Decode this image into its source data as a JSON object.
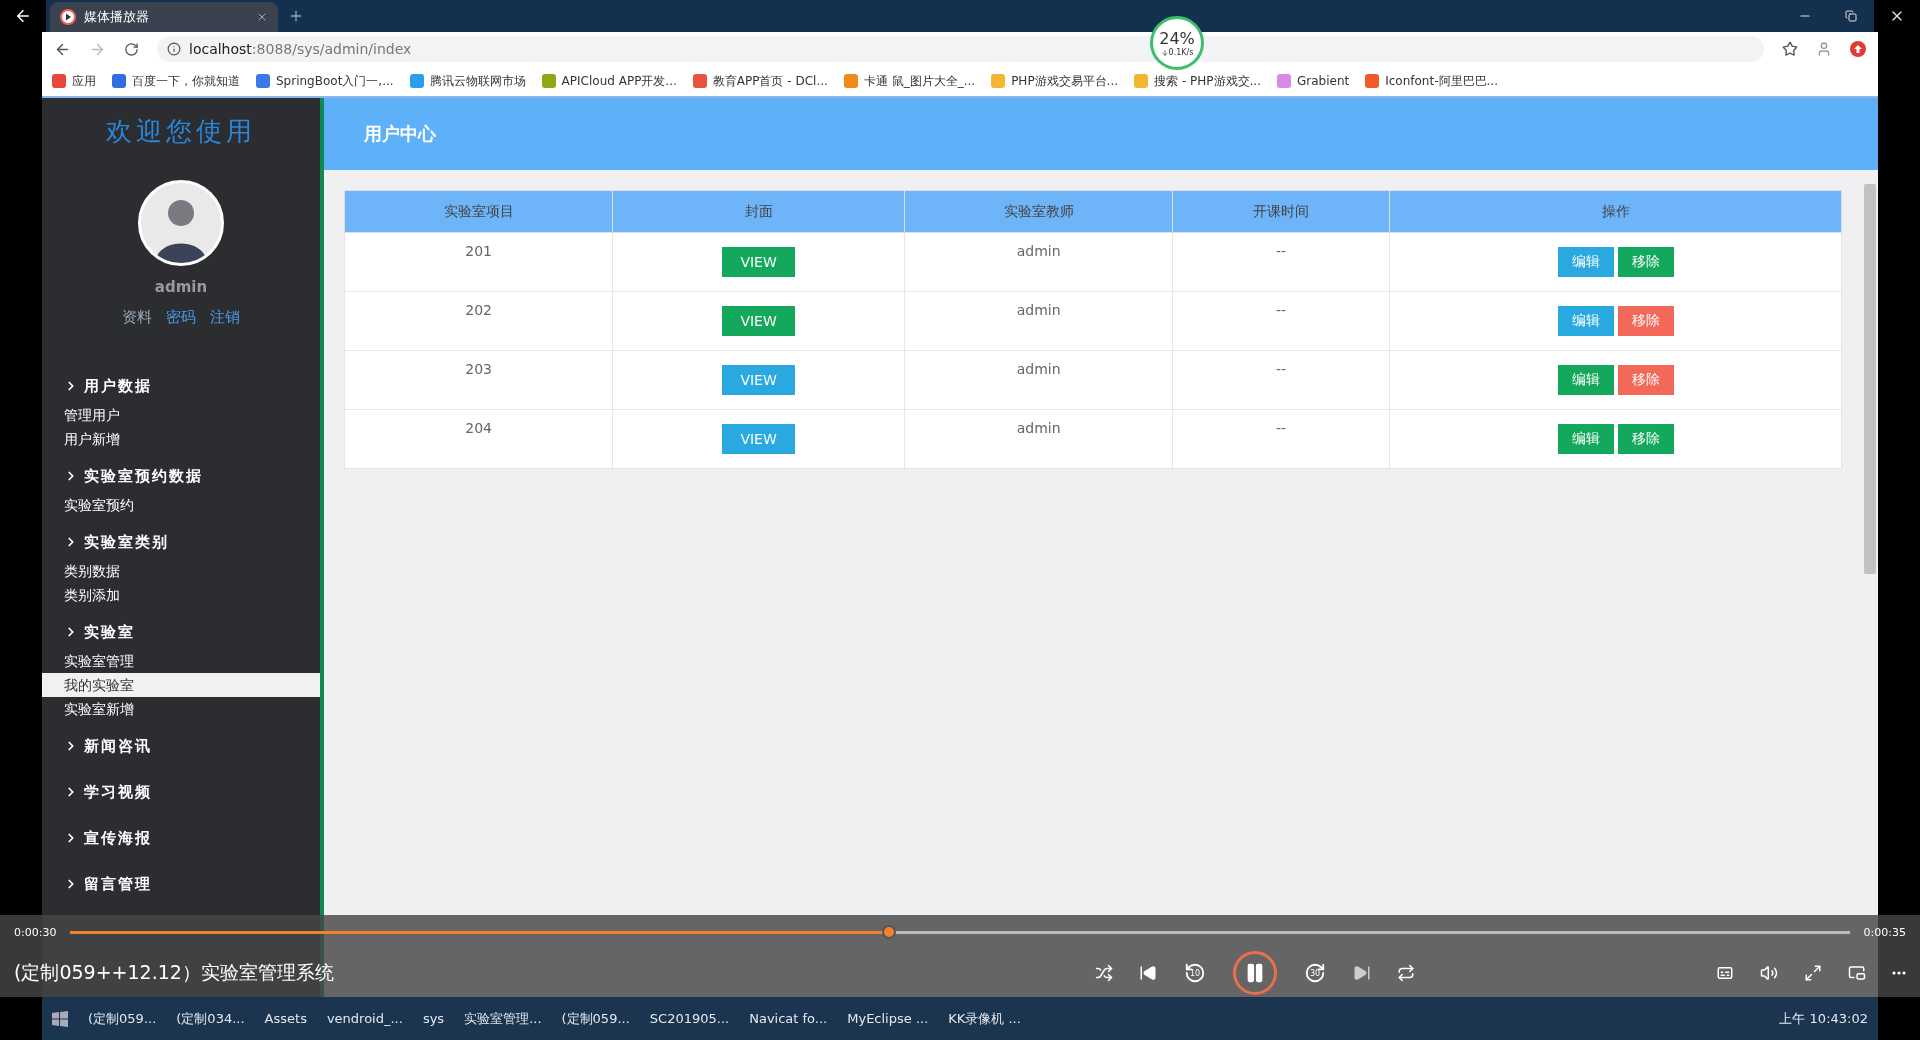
{
  "player": {
    "tab_title": "媒体播放器",
    "elapsed": "0:00:30",
    "total": "0:00:35",
    "level": 0.46,
    "video_title": "(定制059++12.12）实验室管理系统",
    "rewind_label": "10",
    "forward_label": "30",
    "playing": true
  },
  "browser": {
    "url_host": "localhost",
    "url_path": ":8088/sys/admin/index",
    "bookmarks": [
      {
        "label": "应用",
        "color": "#e8453c"
      },
      {
        "label": "百度一下，你就知道",
        "color": "#2f6fdf"
      },
      {
        "label": "SpringBoot入门一,...",
        "color": "#3b78e7"
      },
      {
        "label": "腾讯云物联网市场",
        "color": "#2a9ff0"
      },
      {
        "label": "APICloud APP开发...",
        "color": "#8fa619"
      },
      {
        "label": "教育APP首页 - DCl...",
        "color": "#e8553c"
      },
      {
        "label": "卡通 鼠_图片大全_...",
        "color": "#f08a1a"
      },
      {
        "label": "PHP游戏交易平台...",
        "color": "#f2b630"
      },
      {
        "label": "搜索 - PHP游戏交...",
        "color": "#f2b630"
      },
      {
        "label": "Grabient",
        "color": "#d98ae8"
      },
      {
        "label": "Iconfont-阿里巴巴...",
        "color": "#f05a28"
      }
    ]
  },
  "speed_widget": {
    "percent": "24%",
    "speed": "0.1K/s"
  },
  "sidebar": {
    "heading": "欢迎您使用",
    "username": "admin",
    "links": [
      "资料",
      "密码",
      "注销"
    ],
    "menu": [
      {
        "label": "用户数据",
        "children": [
          {
            "label": "管理用户",
            "selected": false
          },
          {
            "label": "用户新增",
            "selected": false
          }
        ]
      },
      {
        "label": "实验室预约数据",
        "children": [
          {
            "label": "实验室预约",
            "selected": false
          }
        ]
      },
      {
        "label": "实验室类别",
        "children": [
          {
            "label": "类别数据",
            "selected": false
          },
          {
            "label": "类别添加",
            "selected": false
          }
        ]
      },
      {
        "label": "实验室",
        "children": [
          {
            "label": "实验室管理",
            "selected": false
          },
          {
            "label": "我的实验室",
            "selected": true
          },
          {
            "label": "实验室新增",
            "selected": false
          }
        ]
      },
      {
        "label": "新闻咨讯"
      },
      {
        "label": "学习视频"
      },
      {
        "label": "宣传海报"
      },
      {
        "label": "留言管理"
      }
    ]
  },
  "header": {
    "title": "用户中心"
  },
  "table": {
    "columns": [
      "实验室项目",
      "封面",
      "实验室教师",
      "开课时间",
      "操作"
    ],
    "rows": [
      {
        "project": "201",
        "teacher": "admin",
        "time": "--",
        "view": {
          "label": "VIEW",
          "color": "#13a85b"
        },
        "edit": {
          "label": "编辑",
          "color": "#2aa8e0"
        },
        "remove": {
          "label": "移除",
          "color": "#13a85b"
        }
      },
      {
        "project": "202",
        "teacher": "admin",
        "time": "--",
        "view": {
          "label": "VIEW",
          "color": "#13a85b"
        },
        "edit": {
          "label": "编辑",
          "color": "#2aa8e0"
        },
        "remove": {
          "label": "移除",
          "color": "#f2695a"
        }
      },
      {
        "project": "203",
        "teacher": "admin",
        "time": "--",
        "view": {
          "label": "VIEW",
          "color": "#2aa8e0"
        },
        "edit": {
          "label": "编辑",
          "color": "#13a85b"
        },
        "remove": {
          "label": "移除",
          "color": "#f2695a"
        }
      },
      {
        "project": "204",
        "teacher": "admin",
        "time": "--",
        "view": {
          "label": "VIEW",
          "color": "#2aa8e0"
        },
        "edit": {
          "label": "编辑",
          "color": "#13a85b"
        },
        "remove": {
          "label": "移除",
          "color": "#13a85b"
        }
      }
    ]
  },
  "taskbar": {
    "items": [
      "(定制059...",
      "(定制034...",
      "Assets",
      "vendroid_...",
      "sys",
      "实验室管理...",
      "(定制059...",
      "SC201905...",
      "Navicat fo...",
      "MyEclipse ...",
      "KK录像机 ..."
    ],
    "clock": "上午 10:43:02"
  }
}
